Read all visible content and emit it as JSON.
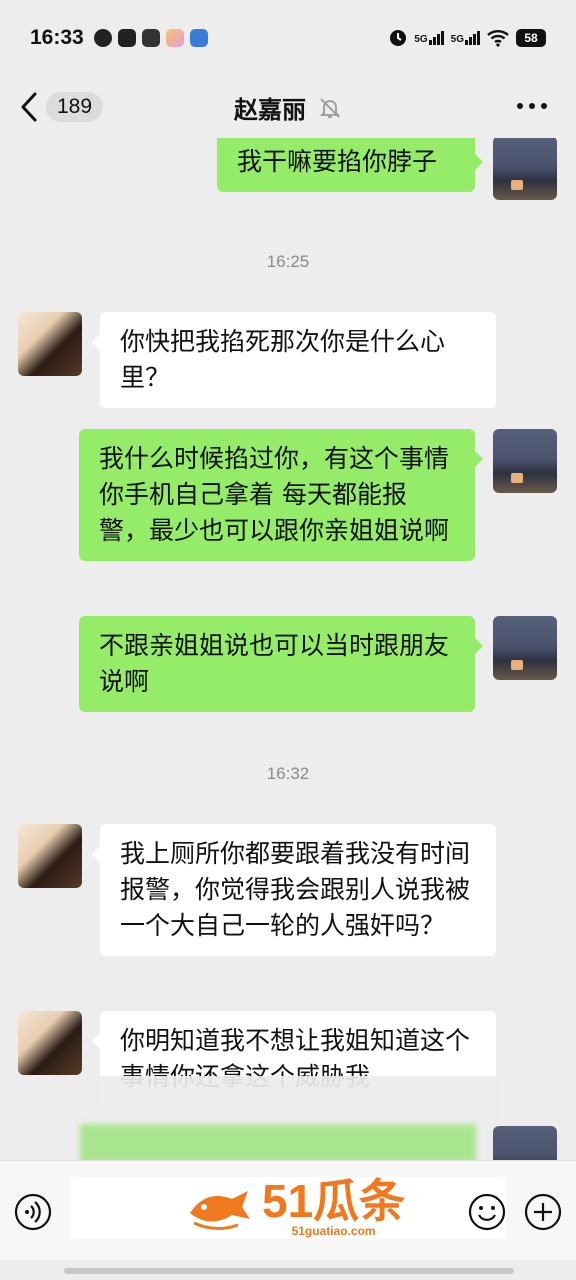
{
  "status_bar": {
    "time": "16:33",
    "network_1": "5G",
    "network_2": "5G",
    "battery": "58"
  },
  "header": {
    "unread_count": "189",
    "title": "赵嘉丽"
  },
  "messages": [
    {
      "side": "out",
      "text": "我干嘛要掐你脖子"
    },
    {
      "type": "time",
      "text": "16:25"
    },
    {
      "side": "in",
      "text": "你快把我掐死那次你是什么心里？"
    },
    {
      "side": "out",
      "text": "我什么时候掐过你，有这个事情你手机自己拿着 每天都能报警，最少也可以跟你亲姐姐说啊"
    },
    {
      "side": "out",
      "text": "不跟亲姐姐说也可以当时跟朋友说啊"
    },
    {
      "type": "time",
      "text": "16:32"
    },
    {
      "side": "in",
      "text": "我上厕所你都要跟着我没有时间报警，你觉得我会跟别人说我被一个大自己一轮的人强奸吗？"
    },
    {
      "side": "in",
      "text": "你明知道我不想让我姐知道这个事情你还拿这个威胁我"
    }
  ],
  "watermark": {
    "main": "51瓜条",
    "sub": "51guatiao.com"
  },
  "colors": {
    "outgoing_bubble": "#95ec69",
    "incoming_bubble": "#ffffff",
    "background": "#ededed",
    "watermark": "#f0781e"
  },
  "icons": {
    "back": "chevron-left-icon",
    "mute": "bell-off-icon",
    "more": "more-dots-icon",
    "voice": "voice-icon",
    "emoji": "emoji-icon",
    "plus": "plus-circle-icon"
  }
}
